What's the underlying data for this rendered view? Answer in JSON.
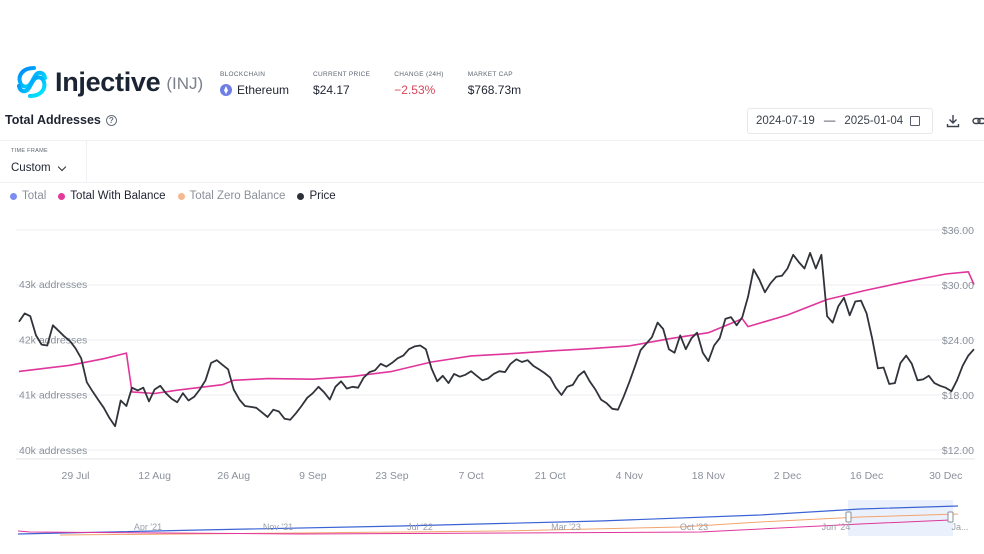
{
  "token": {
    "name": "Injective",
    "symbol": "(INJ)"
  },
  "stats": [
    {
      "label": "BLOCKCHAIN",
      "value": "Ethereum",
      "icon": "ethereum-icon"
    },
    {
      "label": "CURRENT PRICE",
      "value": "$24.17"
    },
    {
      "label": "CHANGE (24H)",
      "value": "−2.53%",
      "color": "#d6455a"
    },
    {
      "label": "MARKET CAP",
      "value": "$768.73m"
    }
  ],
  "section": {
    "title": "Total Addresses"
  },
  "date_range": {
    "start": "2024-07-19",
    "separator": "—",
    "end": "2025-01-04"
  },
  "timeframe": {
    "label": "TIME FRAME",
    "value": "Custom"
  },
  "legend": [
    {
      "label": "Total",
      "color": "#7b8ef0",
      "active": false
    },
    {
      "label": "Total With Balance",
      "color": "#e23a9a",
      "active": true
    },
    {
      "label": "Total Zero Balance",
      "color": "#f6b88e",
      "active": false
    },
    {
      "label": "Price",
      "color": "#2b2f36",
      "active": true
    }
  ],
  "colors": {
    "with_balance": "#e0359b",
    "price": "#30343a",
    "grid": "#eceef2",
    "nav_total": "#3b63d6",
    "nav_zero": "#f2a46e",
    "nav_with_balance": "#e0359b"
  },
  "chart_data": {
    "type": "line",
    "x_range": [
      "2024-07-19",
      "2025-01-04"
    ],
    "x_ticks": [
      "29 Jul",
      "12 Aug",
      "26 Aug",
      "9 Sep",
      "23 Sep",
      "7 Oct",
      "21 Oct",
      "4 Nov",
      "18 Nov",
      "2 Dec",
      "16 Dec",
      "30 Dec"
    ],
    "y_left": {
      "label_suffix": " addresses",
      "ticks": [
        "40k",
        "41k",
        "42k",
        "43k"
      ],
      "range": [
        40000,
        43000
      ]
    },
    "y_right": {
      "ticks": [
        "$12.00",
        "$18.00",
        "$24.00",
        "$30.00",
        "$36.00"
      ],
      "range": [
        12,
        36
      ]
    },
    "series": [
      {
        "name": "Total With Balance",
        "axis": "left",
        "points": [
          [
            "2024-07-19",
            41420
          ],
          [
            "2024-07-28",
            41530
          ],
          [
            "2024-08-03",
            41650
          ],
          [
            "2024-08-07",
            41750
          ],
          [
            "2024-08-08",
            41050
          ],
          [
            "2024-08-12",
            41020
          ],
          [
            "2024-08-16",
            41080
          ],
          [
            "2024-08-24",
            41180
          ],
          [
            "2024-08-26",
            41260
          ],
          [
            "2024-09-01",
            41290
          ],
          [
            "2024-09-09",
            41280
          ],
          [
            "2024-09-16",
            41330
          ],
          [
            "2024-09-23",
            41420
          ],
          [
            "2024-09-30",
            41590
          ],
          [
            "2024-10-07",
            41700
          ],
          [
            "2024-10-14",
            41740
          ],
          [
            "2024-10-21",
            41790
          ],
          [
            "2024-10-28",
            41830
          ],
          [
            "2024-11-04",
            41880
          ],
          [
            "2024-11-11",
            42010
          ],
          [
            "2024-11-18",
            42120
          ],
          [
            "2024-11-24",
            42370
          ],
          [
            "2024-11-25",
            42230
          ],
          [
            "2024-12-02",
            42440
          ],
          [
            "2024-12-09",
            42720
          ],
          [
            "2024-12-16",
            42890
          ],
          [
            "2024-12-23",
            43040
          ],
          [
            "2024-12-30",
            43180
          ],
          [
            "2025-01-03",
            43220
          ],
          [
            "2025-01-04",
            42990
          ]
        ]
      },
      {
        "name": "Price",
        "axis": "right",
        "points": [
          [
            "2024-07-19",
            26.0
          ],
          [
            "2024-07-20",
            26.9
          ],
          [
            "2024-07-21",
            26.6
          ],
          [
            "2024-07-22",
            24.5
          ],
          [
            "2024-07-23",
            23.5
          ],
          [
            "2024-07-24",
            23.4
          ],
          [
            "2024-07-25",
            25.6
          ],
          [
            "2024-07-26",
            25.0
          ],
          [
            "2024-07-27",
            24.4
          ],
          [
            "2024-07-28",
            23.9
          ],
          [
            "2024-07-29",
            23.1
          ],
          [
            "2024-07-30",
            22.0
          ],
          [
            "2024-07-31",
            19.4
          ],
          [
            "2024-08-01",
            18.4
          ],
          [
            "2024-08-02",
            17.5
          ],
          [
            "2024-08-03",
            16.6
          ],
          [
            "2024-08-04",
            15.5
          ],
          [
            "2024-08-05",
            14.6
          ],
          [
            "2024-08-06",
            17.4
          ],
          [
            "2024-08-07",
            16.8
          ],
          [
            "2024-08-08",
            18.8
          ],
          [
            "2024-08-09",
            18.5
          ],
          [
            "2024-08-10",
            18.8
          ],
          [
            "2024-08-11",
            17.3
          ],
          [
            "2024-08-12",
            18.6
          ],
          [
            "2024-08-13",
            19.0
          ],
          [
            "2024-08-14",
            18.2
          ],
          [
            "2024-08-15",
            17.6
          ],
          [
            "2024-08-16",
            17.2
          ],
          [
            "2024-08-17",
            18.2
          ],
          [
            "2024-08-18",
            17.4
          ],
          [
            "2024-08-19",
            17.8
          ],
          [
            "2024-08-20",
            18.6
          ],
          [
            "2024-08-21",
            19.6
          ],
          [
            "2024-08-22",
            21.5
          ],
          [
            "2024-08-23",
            21.8
          ],
          [
            "2024-08-24",
            21.3
          ],
          [
            "2024-08-25",
            20.8
          ],
          [
            "2024-08-26",
            18.6
          ],
          [
            "2024-08-27",
            17.5
          ],
          [
            "2024-08-28",
            16.8
          ],
          [
            "2024-08-29",
            16.7
          ],
          [
            "2024-08-30",
            16.6
          ],
          [
            "2024-08-31",
            16.1
          ],
          [
            "2024-09-01",
            15.6
          ],
          [
            "2024-09-02",
            16.4
          ],
          [
            "2024-09-03",
            16.2
          ],
          [
            "2024-09-04",
            15.4
          ],
          [
            "2024-09-05",
            15.3
          ],
          [
            "2024-09-06",
            16.0
          ],
          [
            "2024-09-07",
            16.8
          ],
          [
            "2024-09-08",
            17.7
          ],
          [
            "2024-09-09",
            18.2
          ],
          [
            "2024-09-10",
            18.9
          ],
          [
            "2024-09-11",
            18.3
          ],
          [
            "2024-09-12",
            17.5
          ],
          [
            "2024-09-13",
            18.9
          ],
          [
            "2024-09-14",
            19.5
          ],
          [
            "2024-09-15",
            18.7
          ],
          [
            "2024-09-16",
            18.9
          ],
          [
            "2024-09-17",
            18.8
          ],
          [
            "2024-09-18",
            19.9
          ],
          [
            "2024-09-19",
            20.5
          ],
          [
            "2024-09-20",
            20.7
          ],
          [
            "2024-09-21",
            21.4
          ],
          [
            "2024-09-22",
            21.1
          ],
          [
            "2024-09-23",
            21.5
          ],
          [
            "2024-09-24",
            22.0
          ],
          [
            "2024-09-25",
            22.3
          ],
          [
            "2024-09-26",
            23.0
          ],
          [
            "2024-09-27",
            23.3
          ],
          [
            "2024-09-28",
            23.4
          ],
          [
            "2024-09-29",
            23.0
          ],
          [
            "2024-09-30",
            20.9
          ],
          [
            "2024-10-01",
            19.5
          ],
          [
            "2024-10-02",
            20.1
          ],
          [
            "2024-10-03",
            19.3
          ],
          [
            "2024-10-04",
            20.3
          ],
          [
            "2024-10-05",
            20.0
          ],
          [
            "2024-10-06",
            20.2
          ],
          [
            "2024-10-07",
            20.6
          ],
          [
            "2024-10-08",
            20.1
          ],
          [
            "2024-10-09",
            19.6
          ],
          [
            "2024-10-10",
            19.8
          ],
          [
            "2024-10-11",
            20.3
          ],
          [
            "2024-10-12",
            20.6
          ],
          [
            "2024-10-13",
            20.5
          ],
          [
            "2024-10-14",
            21.4
          ],
          [
            "2024-10-15",
            21.9
          ],
          [
            "2024-10-16",
            21.6
          ],
          [
            "2024-10-17",
            21.8
          ],
          [
            "2024-10-18",
            21.2
          ],
          [
            "2024-10-19",
            20.8
          ],
          [
            "2024-10-20",
            20.4
          ],
          [
            "2024-10-21",
            19.9
          ],
          [
            "2024-10-22",
            18.8
          ],
          [
            "2024-10-23",
            18.0
          ],
          [
            "2024-10-24",
            18.9
          ],
          [
            "2024-10-25",
            19.1
          ],
          [
            "2024-10-26",
            20.1
          ],
          [
            "2024-10-27",
            20.6
          ],
          [
            "2024-10-28",
            19.5
          ],
          [
            "2024-10-29",
            18.6
          ],
          [
            "2024-10-30",
            17.5
          ],
          [
            "2024-10-31",
            17.1
          ],
          [
            "2024-11-01",
            16.5
          ],
          [
            "2024-11-02",
            16.4
          ],
          [
            "2024-11-03",
            17.8
          ],
          [
            "2024-11-04",
            19.4
          ],
          [
            "2024-11-05",
            21.1
          ],
          [
            "2024-11-06",
            22.9
          ],
          [
            "2024-11-07",
            23.6
          ],
          [
            "2024-11-08",
            24.3
          ],
          [
            "2024-11-09",
            25.9
          ],
          [
            "2024-11-10",
            25.2
          ],
          [
            "2024-11-11",
            23.0
          ],
          [
            "2024-11-12",
            22.6
          ],
          [
            "2024-11-13",
            24.5
          ],
          [
            "2024-11-14",
            23.0
          ],
          [
            "2024-11-15",
            24.2
          ],
          [
            "2024-11-16",
            24.8
          ],
          [
            "2024-11-17",
            22.6
          ],
          [
            "2024-11-18",
            21.7
          ],
          [
            "2024-11-19",
            23.4
          ],
          [
            "2024-11-20",
            24.2
          ],
          [
            "2024-11-21",
            26.3
          ],
          [
            "2024-11-22",
            26.5
          ],
          [
            "2024-11-23",
            25.6
          ],
          [
            "2024-11-24",
            26.5
          ],
          [
            "2024-11-25",
            28.7
          ],
          [
            "2024-11-26",
            31.7
          ],
          [
            "2024-11-27",
            30.6
          ],
          [
            "2024-11-28",
            29.2
          ],
          [
            "2024-11-29",
            30.2
          ],
          [
            "2024-11-30",
            30.9
          ],
          [
            "2024-12-01",
            31.0
          ],
          [
            "2024-12-02",
            31.8
          ],
          [
            "2024-12-03",
            33.3
          ],
          [
            "2024-12-04",
            32.5
          ],
          [
            "2024-12-05",
            31.8
          ],
          [
            "2024-12-06",
            33.5
          ],
          [
            "2024-12-07",
            31.8
          ],
          [
            "2024-12-08",
            33.3
          ],
          [
            "2024-12-09",
            26.6
          ],
          [
            "2024-12-10",
            25.9
          ],
          [
            "2024-12-11",
            27.7
          ],
          [
            "2024-12-12",
            28.6
          ],
          [
            "2024-12-13",
            26.7
          ],
          [
            "2024-12-14",
            28.2
          ],
          [
            "2024-12-15",
            28.3
          ],
          [
            "2024-12-16",
            26.9
          ],
          [
            "2024-12-17",
            24.1
          ],
          [
            "2024-12-18",
            20.9
          ],
          [
            "2024-12-19",
            21.0
          ],
          [
            "2024-12-20",
            19.2
          ],
          [
            "2024-12-21",
            19.3
          ],
          [
            "2024-12-22",
            21.5
          ],
          [
            "2024-12-23",
            22.3
          ],
          [
            "2024-12-24",
            21.4
          ],
          [
            "2024-12-25",
            19.6
          ],
          [
            "2024-12-26",
            19.7
          ],
          [
            "2024-12-27",
            20.1
          ],
          [
            "2024-12-28",
            19.3
          ],
          [
            "2024-12-29",
            19.0
          ],
          [
            "2024-12-30",
            18.8
          ],
          [
            "2024-12-31",
            18.4
          ],
          [
            "2025-01-01",
            19.6
          ],
          [
            "2025-01-02",
            21.2
          ],
          [
            "2025-01-03",
            22.3
          ],
          [
            "2025-01-04",
            23.0
          ]
        ]
      }
    ],
    "grid": true
  },
  "navigator": {
    "labels": [
      "Apr '21",
      "Nov '21",
      "Jul '22",
      "Mar '23",
      "Oct '23",
      "Jun '24",
      "Ja..."
    ]
  }
}
